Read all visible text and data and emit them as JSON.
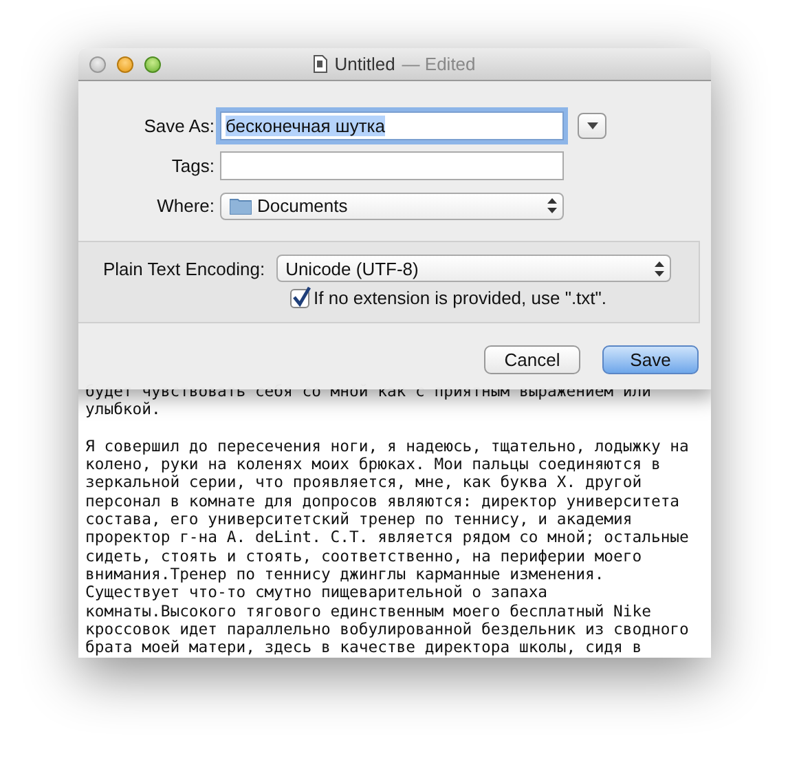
{
  "window": {
    "title": "Untitled",
    "status": "— Edited"
  },
  "save_sheet": {
    "save_as": {
      "label": "Save As:",
      "value": "бесконечная шутка"
    },
    "tags": {
      "label": "Tags:"
    },
    "where": {
      "label": "Where:",
      "value": "Documents"
    },
    "encoding": {
      "label": "Plain Text Encoding:",
      "value": "Unicode (UTF-8)"
    },
    "extension_option": {
      "label": "If no extension is provided, use \".txt\".",
      "checked": true
    },
    "buttons": [
      {
        "label": "Cancel",
        "kind": "normal"
      },
      {
        "label": "Save",
        "kind": "default"
      }
    ]
  },
  "document": {
    "paragraphs": [
      "будет чувствовать себя со мной как с приятным выражением или улыбкой.",
      "Я совершил до пересечения ноги, я надеюсь, тщательно, лодыжку на колено, руки на коленях моих брюках. Мои пальцы соединяются в зеркальной серии, что проявляется, мне, как буква X. другой персонал в комнате для допросов являются: директор университета состава, его университетский тренер по теннису, и академия проректор г-на A. deLint. С.Т. является рядом со мной; остальные сидеть, стоять и стоять, соответственно, на периферии моего внимания.Тренер по теннису джинглы карманные изменения. Существует что-то смутно пищеварительной о запаха комнаты.Высокого тягового единственным моего бесплатный Nike кроссовок идет параллельно вобулированной бездельник из сводного брата моей матери, здесь в качестве директора школы, сидя в"
    ]
  }
}
